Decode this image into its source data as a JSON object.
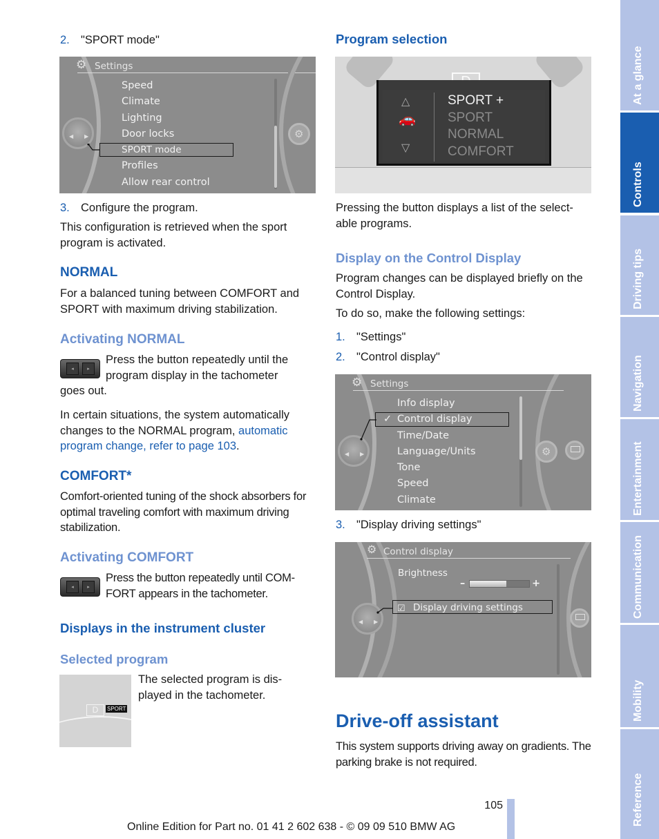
{
  "left_column": {
    "step2": {
      "num": "2.",
      "text": "\"SPORT mode\""
    },
    "settings_screen": {
      "title": "Settings",
      "items": [
        "Speed",
        "Climate",
        "Lighting",
        "Door locks",
        "SPORT mode",
        "Profiles",
        "Allow rear control"
      ],
      "selected": "SPORT mode"
    },
    "step3": {
      "num": "3.",
      "text": "Configure the program."
    },
    "config_text": "This configuration is retrieved when the sport program is activated.",
    "normal": {
      "heading": "NORMAL",
      "text": "For a balanced tuning between COMFORT and SPORT with maximum driving stabilization.",
      "activating_heading": "Activating NORMAL",
      "activating_text_1": "Press the button repeatedly until the program display in the tachometer",
      "activating_text_2": "goes out.",
      "situations_text": "In certain situations, the system automatically changes to the NORMAL program, ",
      "situations_link": "automatic program change, refer to page 103",
      "situations_end": "."
    },
    "comfort": {
      "heading": "COMFORT*",
      "text": "Comfort-oriented tuning of the shock absorbers for optimal traveling comfort with maximum driving stabilization.",
      "activating_heading": "Activating COMFORT",
      "activating_text": "Press the button repeatedly until COM-FORT appears in the tachometer."
    },
    "cluster": {
      "heading": "Displays in the instrument cluster",
      "selected_heading": "Selected program",
      "selected_text": "The selected program is dis-played in the tachometer.",
      "gear": "D",
      "program_badge": "SPORT"
    }
  },
  "right_column": {
    "program_selection": {
      "heading": "Program selection",
      "gear": "D",
      "programs": [
        "SPORT +",
        "SPORT",
        "NORMAL",
        "COMFORT"
      ],
      "active_program": "SPORT +",
      "text": "Pressing the button displays a list of the select-able programs."
    },
    "control_display": {
      "heading": "Display on the Control Display",
      "text1": "Program changes can be displayed briefly on the Control Display.",
      "text2": "To do so, make the following settings:",
      "steps": [
        {
          "num": "1.",
          "text": "\"Settings\""
        },
        {
          "num": "2.",
          "text": "\"Control display\""
        }
      ],
      "settings_screen": {
        "title": "Settings",
        "items": [
          "Info display",
          "Control display",
          "Time/Date",
          "Language/Units",
          "Tone",
          "Speed",
          "Climate"
        ],
        "selected": "Control display",
        "check": "✓"
      },
      "step3": {
        "num": "3.",
        "text": "\"Display driving settings\""
      },
      "control_screen": {
        "title": "Control display",
        "brightness_label": "Brightness",
        "brightness_minus": "–",
        "brightness_plus": "+",
        "brightness_level": 0.62,
        "option": "Display driving settings",
        "option_checked": true
      }
    },
    "drive_off": {
      "heading": "Drive-off assistant",
      "text": "This system supports driving away on gradients. The parking brake is not required."
    }
  },
  "side_tabs": [
    {
      "label": "At a glance",
      "active": false
    },
    {
      "label": "Controls",
      "active": true
    },
    {
      "label": "Driving tips",
      "active": false
    },
    {
      "label": "Navigation",
      "active": false
    },
    {
      "label": "Entertainment",
      "active": false
    },
    {
      "label": "Communication",
      "active": false
    },
    {
      "label": "Mobility",
      "active": false
    },
    {
      "label": "Reference",
      "active": false
    }
  ],
  "footer": {
    "page_number": "105",
    "edition": "Online Edition for Part no. 01 41 2 602 638 - © 09 09 510 BMW AG"
  },
  "colors": {
    "heading_blue": "#1a5eb0",
    "subheading_blue": "#6e92d0",
    "tab_inactive": "#b3c2e6",
    "tab_active": "#1a5eb0"
  }
}
